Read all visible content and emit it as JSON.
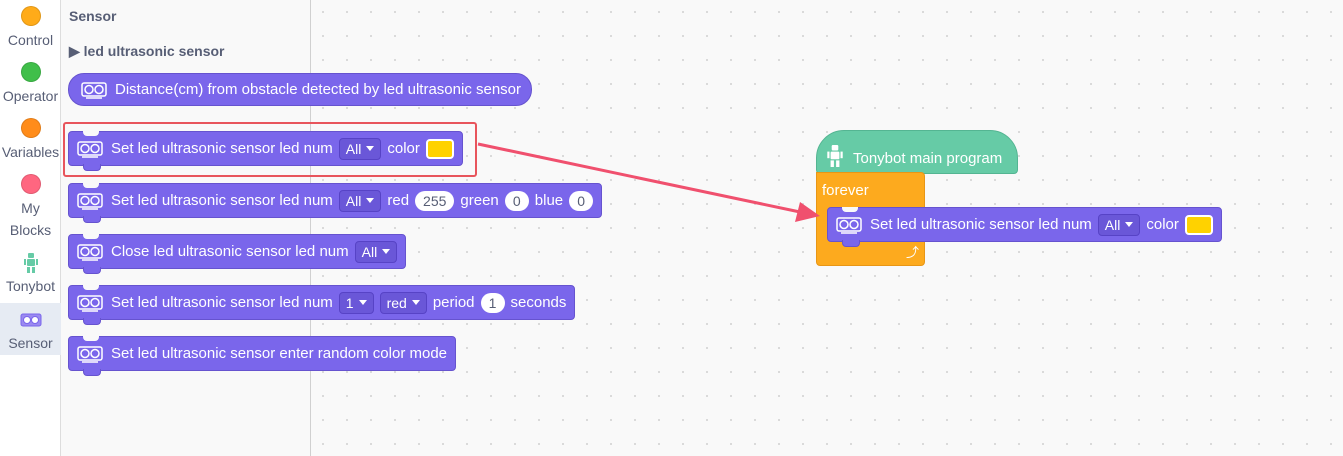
{
  "categories": [
    {
      "label": "Control",
      "color": "#ffab19"
    },
    {
      "label": "Operator",
      "color": "#40bf4a"
    },
    {
      "label": "Variables",
      "color": "#ff8c1a"
    },
    {
      "label": "My Blocks",
      "color": "#ff6680"
    },
    {
      "label": "Tonybot",
      "icon": "robot-icon"
    },
    {
      "label": "Sensor",
      "icon": "ultrasonic-sensor-icon",
      "selected": true
    }
  ],
  "flyout": {
    "title": "Sensor",
    "section": "▶ led ultrasonic sensor",
    "blocks": {
      "distance": {
        "text": "Distance(cm) from obstacle detected by led ultrasonic sensor"
      },
      "set_color": {
        "prefix": "Set led ultrasonic sensor led num",
        "dropdown": "All",
        "suffix": "color",
        "color": "#ffd200"
      },
      "set_rgb": {
        "prefix": "Set led ultrasonic sensor led num",
        "dropdown": "All",
        "red_label": "red",
        "red": "255",
        "green_label": "green",
        "green": "0",
        "blue_label": "blue",
        "blue": "0"
      },
      "close": {
        "prefix": "Close led ultrasonic sensor led num",
        "dropdown": "All"
      },
      "blink": {
        "prefix": "Set led ultrasonic sensor led num",
        "dropdown": "1",
        "color_dropdown": "red",
        "period_label": "period",
        "period": "1",
        "seconds_label": "seconds"
      },
      "random": {
        "text": "Set led ultrasonic sensor enter random color mode"
      }
    }
  },
  "workspace": {
    "hat_label": "Tonybot main program",
    "forever_label": "forever",
    "loop_symbol": "⤴",
    "inner_block": {
      "prefix": "Set led ultrasonic sensor led num",
      "dropdown": "All",
      "suffix": "color",
      "color": "#ffd200"
    }
  },
  "colors": {
    "sensor_block": "#7a66eb",
    "control_block": "#fdaa1e",
    "tonybot_block": "#66cba6",
    "highlight": "#e8555c",
    "arrow": "#f0506e"
  }
}
